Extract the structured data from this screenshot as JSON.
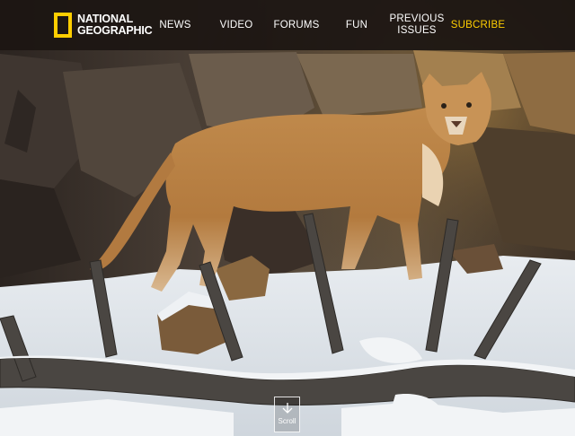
{
  "header": {
    "logo": {
      "line1": "NATIONAL",
      "line2": "GEOGRAPHIC"
    },
    "nav": [
      {
        "label": "NEWS"
      },
      {
        "label": "VIDEO"
      },
      {
        "label": "FORUMS"
      },
      {
        "label": "FUN"
      },
      {
        "label_line1": "PREVIOUS",
        "label_line2": "ISSUES"
      },
      {
        "label": "SUBCRIBE"
      }
    ]
  },
  "hero": {
    "scroll_label": "Scroll",
    "scroll_icon": "arrow-down-icon"
  },
  "colors": {
    "accent": "#ffce00",
    "nav_bg": "#1c1612",
    "nav_text": "#ffffff"
  }
}
